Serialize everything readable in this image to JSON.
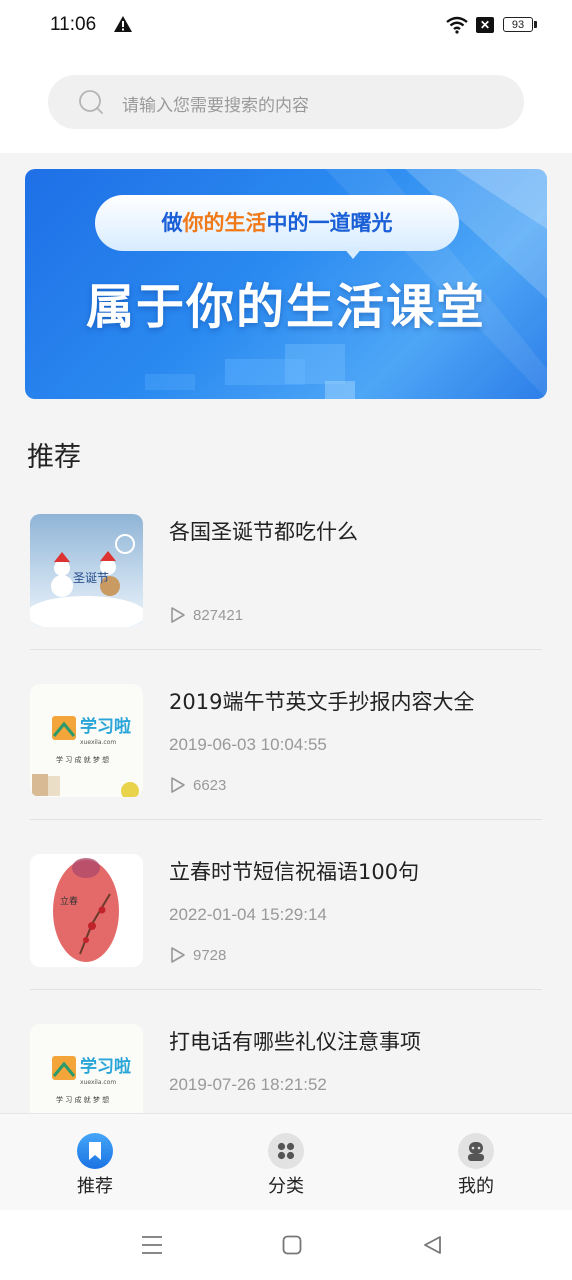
{
  "status_bar": {
    "time": "11:06",
    "battery": "93"
  },
  "search": {
    "placeholder": "请输入您需要搜索的内容"
  },
  "banner": {
    "tagline_part1": "做",
    "tagline_part2": "你的生活",
    "tagline_part3": "中的一道曙光",
    "headline": "属于你的生活课堂"
  },
  "section": {
    "title": "推荐"
  },
  "items": [
    {
      "title": "各国圣诞节都吃什么",
      "date": "",
      "views": "827421"
    },
    {
      "title": "2019端午节英文手抄报内容大全",
      "date": "2019-06-03 10:04:55",
      "views": "6623"
    },
    {
      "title": "立春时节短信祝福语100句",
      "date": "2022-01-04 15:29:14",
      "views": "9728"
    },
    {
      "title": "打电话有哪些礼仪注意事项",
      "date": "2019-07-26 18:21:52",
      "views": ""
    }
  ],
  "thumb_text": {
    "christmas": "圣诞节",
    "brand": "学习啦",
    "brand_url": "xuexila.com",
    "brand_slogan": "学 习 成 就 梦 想",
    "spring": "立春"
  },
  "tabs": [
    {
      "label": "推荐",
      "active": true
    },
    {
      "label": "分类",
      "active": false
    },
    {
      "label": "我的",
      "active": false
    }
  ],
  "colors": {
    "accent": "#2a8af0",
    "orange": "#f07a1a",
    "muted": "#999999"
  }
}
